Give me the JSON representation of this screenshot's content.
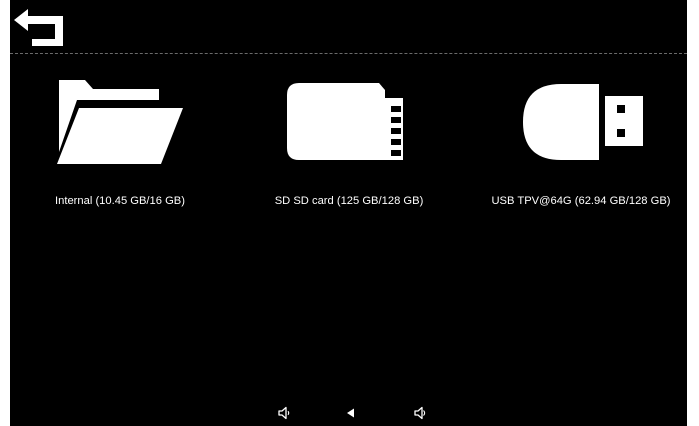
{
  "topbar": {
    "back_icon": "return-arrow-icon"
  },
  "storage": {
    "items": [
      {
        "icon": "folder-open-icon",
        "label": "Internal (10.45 GB/16 GB)"
      },
      {
        "icon": "sd-card-icon",
        "label": "SD SD card (125 GB/128 GB)"
      },
      {
        "icon": "usb-drive-icon",
        "label": "USB TPV@64G (62.94 GB/128 GB)"
      }
    ]
  },
  "navbar": {
    "items": [
      {
        "icon": "volume-down-icon"
      },
      {
        "icon": "back-triangle-icon"
      },
      {
        "icon": "volume-up-icon"
      }
    ]
  },
  "colors": {
    "background": "#000000",
    "foreground": "#ffffff",
    "divider": "#6a6a6a"
  }
}
